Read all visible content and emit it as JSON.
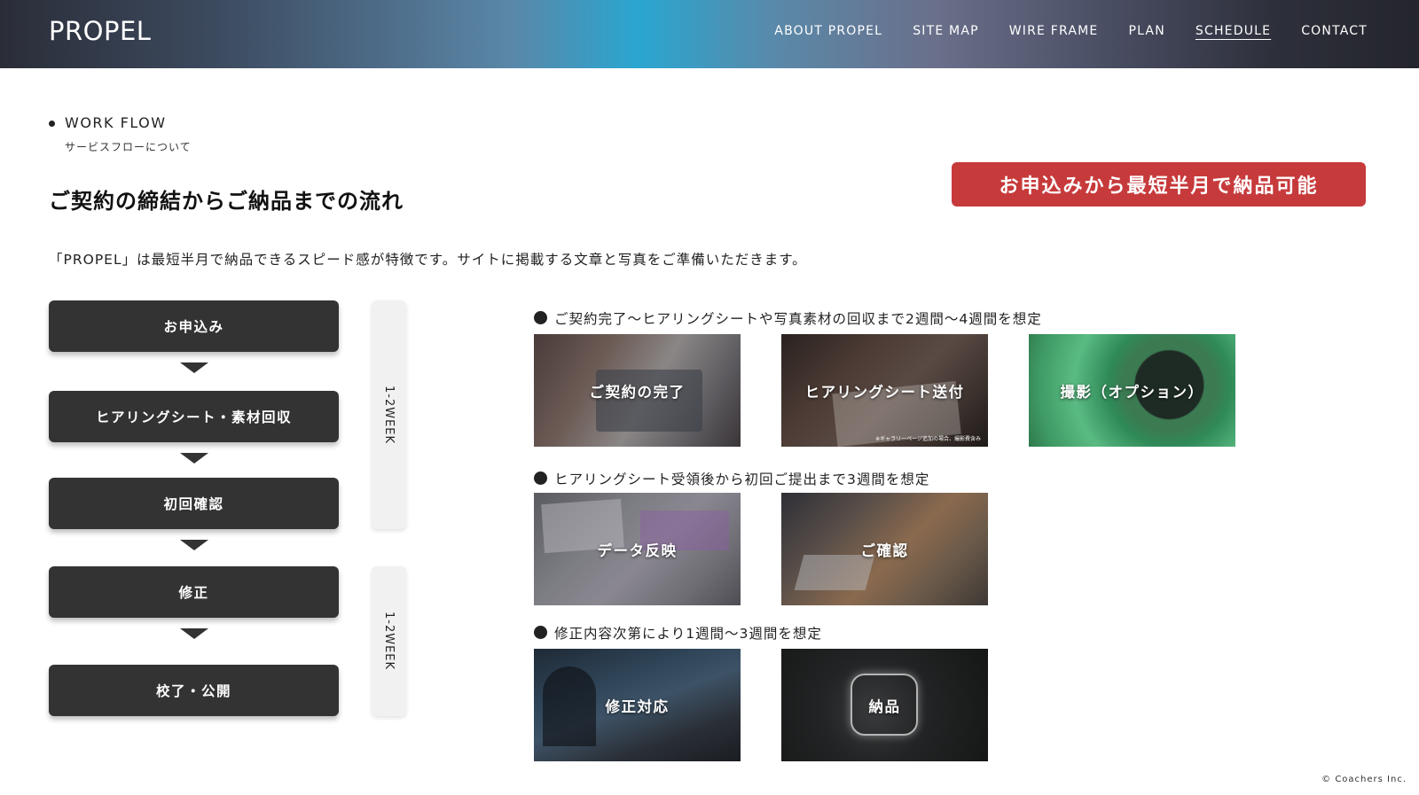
{
  "header": {
    "logo": "PROPEL",
    "nav": [
      "ABOUT PROPEL",
      "SITE MAP",
      "WIRE FRAME",
      "PLAN",
      "SCHEDULE",
      "CONTACT"
    ],
    "active_nav": "SCHEDULE"
  },
  "section": {
    "title": "WORK FLOW",
    "subtitle": "サービスフローについて"
  },
  "heading": "ご契約の締結からご納品までの流れ",
  "cta_badge": "お申込みから最短半月で納品可能",
  "description": "「PROPEL」は最短半月で納品できるスピード感が特徴です。サイトに掲載する文章と写真をご準備いただきます。",
  "steps": [
    "お申込み",
    "ヒアリングシート・素材回収",
    "初回確認",
    "修正",
    "校了・公開"
  ],
  "week_labels": [
    "1-2WEEK",
    "1-2WEEK"
  ],
  "groups": [
    {
      "title": "ご契約完了〜ヒアリングシートや写真素材の回収まで2週間〜4週間を想定",
      "tiles": [
        "ご契約の完了",
        "ヒアリングシート送付",
        "撮影（オプション）"
      ],
      "note": "※ギャラリーページ追加の場合、撮影費含み"
    },
    {
      "title": "ヒアリングシート受領後から初回ご提出まで3週間を想定",
      "tiles": [
        "データ反映",
        "ご確認"
      ]
    },
    {
      "title": "修正内容次第により1週間〜3週間を想定",
      "tiles": [
        "修正対応",
        "納品"
      ]
    }
  ],
  "footer": "© Coachers Inc.",
  "colors": {
    "accent_red": "#c73a3b",
    "step_dark": "#333333"
  }
}
